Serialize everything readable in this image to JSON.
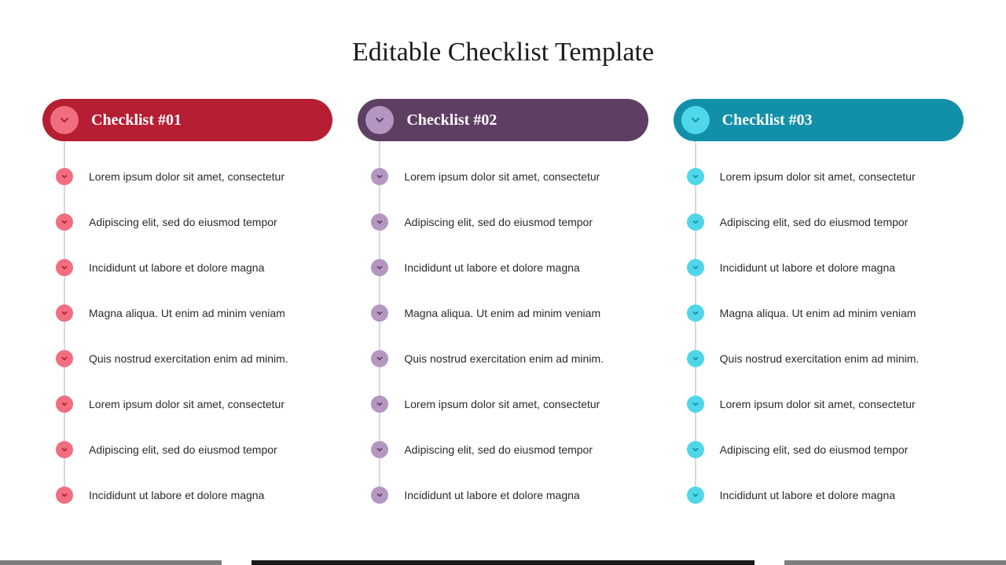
{
  "title": "Editable Checklist Template",
  "columns": [
    {
      "header": "Checklist #01",
      "items": [
        "Lorem ipsum dolor sit amet, consectetur",
        "Adipiscing elit, sed do eiusmod tempor",
        "Incididunt ut labore et dolore magna",
        "Magna aliqua. Ut enim ad minim veniam",
        "Quis nostrud exercitation enim ad minim.",
        "Lorem ipsum dolor sit amet, consectetur",
        "Adipiscing elit, sed do eiusmod tempor",
        "Incididunt ut labore et dolore magna"
      ]
    },
    {
      "header": "Checklist #02",
      "items": [
        "Lorem ipsum dolor sit amet, consectetur",
        "Adipiscing elit, sed do eiusmod tempor",
        "Incididunt ut labore et dolore magna",
        "Magna aliqua. Ut enim ad minim veniam",
        "Quis nostrud exercitation enim ad minim.",
        "Lorem ipsum dolor sit amet, consectetur",
        "Adipiscing elit, sed do eiusmod tempor",
        "Incididunt ut labore et dolore magna"
      ]
    },
    {
      "header": "Checklist #03",
      "items": [
        "Lorem ipsum dolor sit amet, consectetur",
        "Adipiscing elit, sed do eiusmod tempor",
        "Incididunt ut labore et dolore magna",
        "Magna aliqua. Ut enim ad minim veniam",
        "Quis nostrud exercitation enim ad minim.",
        "Lorem ipsum dolor sit amet, consectetur",
        "Adipiscing elit, sed do eiusmod tempor",
        "Incididunt ut labore et dolore magna"
      ]
    }
  ]
}
